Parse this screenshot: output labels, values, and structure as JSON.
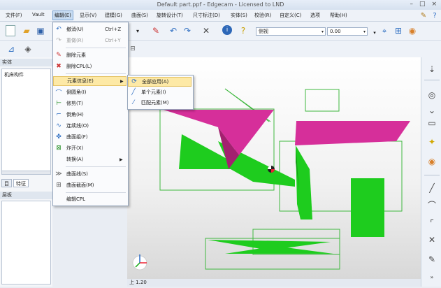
{
  "window": {
    "title": "Default part.ppf - Edgecam - Licensed to LND",
    "min": "–",
    "max": "□",
    "close": "×"
  },
  "menubar": {
    "items": [
      "文件(F)",
      "Vault",
      "编辑(E)",
      "显示(V)",
      "建模(G)",
      "曲面(S)",
      "旋转设计(T)",
      "尺寸标注(D)",
      "实体(S)",
      "校验(R)",
      "自定义(C)",
      "选项",
      "帮助(H)"
    ]
  },
  "toolbar": {
    "layer_value": "侧视",
    "grade_value": "0.00"
  },
  "left_panel": {
    "header1": "实体",
    "tree_item": "机床构件",
    "tabs": [
      "目",
      "特征"
    ],
    "header2": "层板"
  },
  "edit_menu": {
    "items": [
      {
        "label": "撤消(U)",
        "shortcut": "Ctrl+Z",
        "disabled": false
      },
      {
        "label": "重做(R)",
        "shortcut": "Ctrl+Y",
        "disabled": true
      },
      {
        "label": "删除元素",
        "shortcut": "",
        "disabled": false
      },
      {
        "label": "删除CPL(L)",
        "shortcut": "",
        "disabled": false
      },
      {
        "label": "元素信息(E)",
        "shortcut": "",
        "submenu": true,
        "highlighted": true
      },
      {
        "label": "倒圆角(I)",
        "shortcut": ""
      },
      {
        "label": "修剪(T)",
        "shortcut": ""
      },
      {
        "label": "倒角(H)",
        "shortcut": ""
      },
      {
        "label": "连续线(O)",
        "shortcut": ""
      },
      {
        "label": "曲面组(F)",
        "shortcut": ""
      },
      {
        "label": "炸开(X)",
        "shortcut": ""
      },
      {
        "label": "转换(A)",
        "shortcut": "",
        "submenu": true
      },
      {
        "label": "曲面线(S)",
        "shortcut": ""
      },
      {
        "label": "曲面截面(M)",
        "shortcut": ""
      },
      {
        "label": "编辑CPL",
        "shortcut": ""
      }
    ]
  },
  "submenu": {
    "items": [
      "全部应用(A)",
      "单个元素(I)",
      "匹配元素(M)"
    ]
  },
  "status": {
    "text": "上 1.20"
  },
  "colors": {
    "magenta": "#d62f9a",
    "green": "#1ecc1e",
    "outline": "#3fb83f"
  }
}
